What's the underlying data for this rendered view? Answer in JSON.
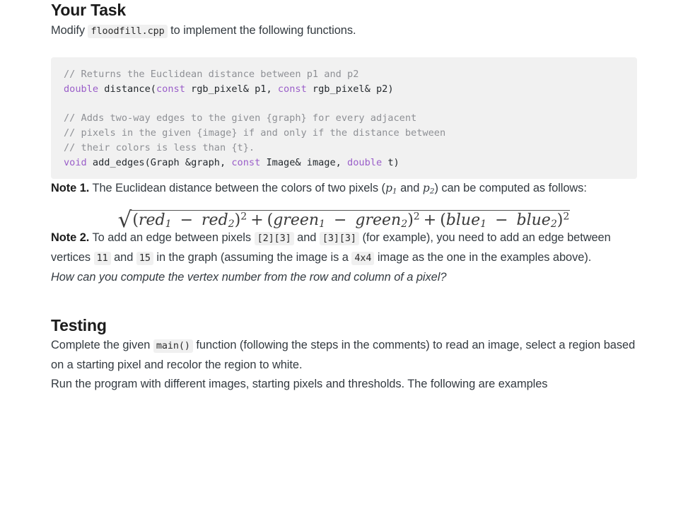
{
  "document": {
    "sections": [
      {
        "id": "your-task",
        "heading": "Your Task",
        "intro": {
          "before": "Modify ",
          "code": "floodfill.cpp",
          "after": " to implement the following functions."
        }
      },
      {
        "id": "testing",
        "heading": "Testing"
      }
    ]
  },
  "code_block": {
    "language": "cpp",
    "lines": [
      [
        {
          "t": "comment",
          "v": "// Returns the Euclidean distance between p1 and p2"
        }
      ],
      [
        {
          "t": "keyword",
          "v": "double"
        },
        {
          "t": "plain",
          "v": " distance("
        },
        {
          "t": "keyword",
          "v": "const"
        },
        {
          "t": "plain",
          "v": " rgb_pixel& p1, "
        },
        {
          "t": "keyword",
          "v": "const"
        },
        {
          "t": "plain",
          "v": " rgb_pixel& p2)"
        }
      ],
      [
        {
          "t": "plain",
          "v": ""
        }
      ],
      [
        {
          "t": "comment",
          "v": "// Adds two-way edges to the given {graph} for every adjacent"
        }
      ],
      [
        {
          "t": "comment",
          "v": "// pixels in the given {image} if and only if the distance between"
        }
      ],
      [
        {
          "t": "comment",
          "v": "// their colors is less than {t}."
        }
      ],
      [
        {
          "t": "keyword",
          "v": "void"
        },
        {
          "t": "plain",
          "v": " add_edges(Graph &graph, "
        },
        {
          "t": "keyword",
          "v": "const"
        },
        {
          "t": "plain",
          "v": " Image& image, "
        },
        {
          "t": "keyword",
          "v": "double"
        },
        {
          "t": "plain",
          "v": " t)"
        }
      ]
    ]
  },
  "note1": {
    "label": "Note 1.",
    "text_a": " The Euclidean distance between the colors of two pixels (",
    "p1": "p",
    "p1_sub": "1",
    "text_b": " and ",
    "p2": "p",
    "p2_sub": "2",
    "text_c": ") can be computed as follows:"
  },
  "formula": {
    "latex": "\\sqrt{(red_1 - red_2)^2 + (green_1 - green_2)^2 + (blue_1 - blue_2)^2}",
    "radical": "√",
    "terms": [
      {
        "open": "(",
        "a": "red",
        "a_sub": "1",
        "minus": "−",
        "b": "red",
        "b_sub": "2",
        "close": ")",
        "power": "2"
      },
      {
        "open": "(",
        "a": "green",
        "a_sub": "1",
        "minus": "−",
        "b": "green",
        "b_sub": "2",
        "close": ")",
        "power": "2"
      },
      {
        "open": "(",
        "a": "blue",
        "a_sub": "1",
        "minus": "−",
        "b": "blue",
        "b_sub": "2",
        "close": ")",
        "power": "2"
      }
    ],
    "plus": "+"
  },
  "note2": {
    "label": "Note 2.",
    "t1": " To add an edge between pixels ",
    "code1": "[2][3]",
    "t2": " and ",
    "code2": "[3][3]",
    "t3": " (for example), you need to add an edge between vertices ",
    "code3": "11",
    "t4": " and ",
    "code4": "15",
    "t5": " in the graph (assuming the image is a ",
    "code5": "4x4",
    "t6": " image as the one in the examples above).",
    "question": "How can you compute the vertex number from the row and column of a pixel?"
  },
  "testing": {
    "para1_a": "Complete the given ",
    "para1_code": "main()",
    "para1_b": " function (following the steps in the comments) to read an image, select a region based on a starting pixel and recolor the region to white.",
    "para2": "Run the program with different images, starting pixels and thresholds. The following are examples"
  },
  "colors": {
    "page_background": "#ffffff",
    "heading": "#1b1b1b",
    "body_text": "#333a40",
    "code_block_background": "#f1f1f1",
    "inline_code_background": "#f0f0f0",
    "code_comment": "#8e9095",
    "code_keyword": "#9a5ec9",
    "code_plain": "#24292e",
    "math": "#3b3b3b"
  }
}
